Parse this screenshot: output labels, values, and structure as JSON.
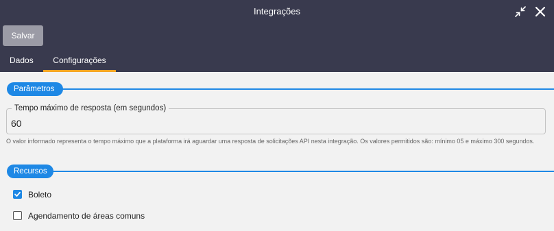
{
  "window": {
    "title": "Integrações",
    "collapse_icon": "collapse-arrows-icon",
    "close_icon": "close-icon"
  },
  "toolbar": {
    "save_label": "Salvar"
  },
  "tabs": [
    {
      "label": "Dados",
      "active": false
    },
    {
      "label": "Configurações",
      "active": true
    }
  ],
  "sections": {
    "parameters": {
      "title": "Parâmetros",
      "timeout_field": {
        "label": "Tempo máximo de resposta (em segundos)",
        "value": "60",
        "helper": "O valor informado representa o tempo máximo que a plataforma irá aguardar uma resposta de solicitações API nesta integração. Os valores permitidos são: mínimo 05 e máximo 300 segundos."
      }
    },
    "resources": {
      "title": "Recursos",
      "items": [
        {
          "label": "Boleto",
          "checked": true
        },
        {
          "label": "Agendamento de áreas comuns",
          "checked": false
        }
      ]
    }
  },
  "colors": {
    "header_bg": "#393a4e",
    "accent_blue": "#1e88e5",
    "tab_underline": "#f5a623",
    "save_button_bg": "#9b9ba6",
    "content_bg": "#f2f2f2"
  }
}
